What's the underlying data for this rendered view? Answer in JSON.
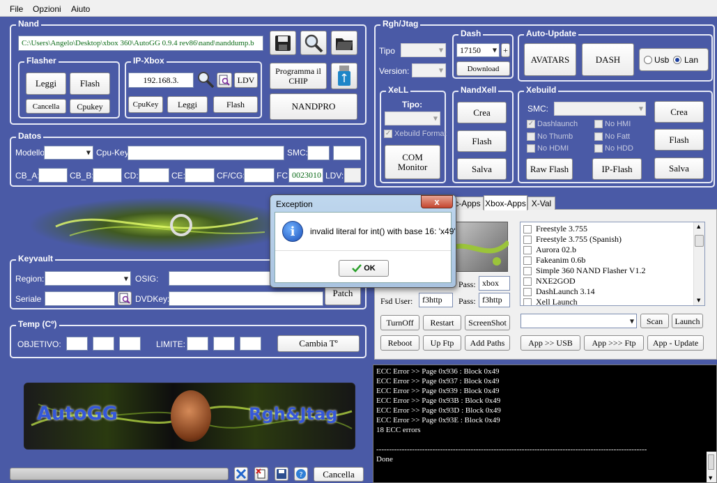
{
  "menu": {
    "file": "File",
    "options": "Opzioni",
    "help": "Aiuto"
  },
  "nand": {
    "title": "Nand",
    "path": "C:\\Users\\Angelo\\Desktop\\xbox 360\\AutoGG 0.9.4 rev86\\nand\\nanddump.b",
    "program_chip": "Programma il CHIP",
    "nandpro": "NANDPRO"
  },
  "flasher": {
    "title": "Flasher",
    "read": "Leggi",
    "flash": "Flash",
    "cancel": "Cancella",
    "cpukey": "Cpukey"
  },
  "ipxbox": {
    "title": "IP-Xbox",
    "ip": "192.168.3.",
    "ldv": "LDV",
    "cpukey": "CpuKey",
    "read": "Leggi",
    "flash": "Flash"
  },
  "rgh": {
    "title": "Rgh/Jtag",
    "type_label": "Tipo",
    "version_label": "Version:"
  },
  "dash": {
    "title": "Dash",
    "value": "17150",
    "plus": "+",
    "download": "Download"
  },
  "autoupdate": {
    "title": "Auto-Update",
    "avatars": "AVATARS",
    "dash": "DASH",
    "usb": "Usb",
    "lan": "Lan"
  },
  "xell": {
    "title": "XeLL",
    "type_label": "Tipo:",
    "xebuild_format": "Xebuild Format",
    "com_monitor": "COM Monitor"
  },
  "nandxell": {
    "title": "NandXell",
    "create": "Crea",
    "flash": "Flash",
    "save": "Salva"
  },
  "xebuild": {
    "title": "Xebuild",
    "smc_label": "SMC:",
    "checks": [
      "Dashlaunch",
      "No HMI",
      "No Thumb",
      "No Fatt",
      "No HDMI",
      "No HDD"
    ],
    "raw_flash": "Raw Flash",
    "ip_flash": "IP-Flash",
    "create": "Crea",
    "flash": "Flash",
    "save": "Salva"
  },
  "datos": {
    "title": "Datos",
    "model_label": "Modello:",
    "cpukey_label": "Cpu-Key",
    "smc_label": "SMC:",
    "cba": "CB_A:",
    "cbb": "CB_B:",
    "cd": "CD:",
    "ce": "CE:",
    "cfcg": "CF/CG:",
    "fc": "FC:",
    "fc_value": "0023010",
    "ldv": "LDV:"
  },
  "keyvault": {
    "title": "Keyvault",
    "region_label": "Region:",
    "osig_label": "OSIG:",
    "serial_label": "Seriale",
    "dvdkey_label": "DVDKey:",
    "patch": "Patch"
  },
  "temp": {
    "title": "Temp (Cº)",
    "target_label": "OBJETIVO:",
    "limit_label": "LIMITE:",
    "change": "Cambia Tº"
  },
  "banner": {
    "left": "AutoGG",
    "right": "Rgh&Jtag"
  },
  "bottom": {
    "cancel": "Cancella"
  },
  "tabs": {
    "apps": "c-Apps",
    "xbox_apps": "Xbox-Apps",
    "xval": "X-Val"
  },
  "ftp": {
    "pass_label": "Pass:",
    "pass1": "xbox",
    "user_label": "Fsd User:",
    "user": "f3http",
    "pass2": "f3http"
  },
  "apps_list": [
    "Freestyle 3.755",
    "Freestyle 3.755 (Spanish)",
    "Aurora 02.b",
    "Fakeanim 0.6b",
    "Simple 360 NAND Flasher V1.2",
    "NXE2GOD",
    "DashLaunch 3.14",
    "Xell Launch"
  ],
  "controls": {
    "turnoff": "TurnOff",
    "restart": "Restart",
    "screenshot": "ScreenShot",
    "reboot": "Reboot",
    "upftp": "Up Ftp",
    "addpaths": "Add Paths",
    "scan": "Scan",
    "launch": "Launch",
    "app_usb": "App >> USB",
    "app_ftp": "App >>> Ftp",
    "app_update": "App - Update"
  },
  "log": [
    "ECC Error >> Page 0x936 : Block 0x49",
    "ECC Error >> Page 0x937 : Block 0x49",
    "ECC Error >> Page 0x939 : Block 0x49",
    "ECC Error >> Page 0x93B : Block 0x49",
    "ECC Error >> Page 0x93D : Block 0x49",
    "ECC Error >> Page 0x93E : Block 0x49",
    "18 ECC errors",
    "",
    "----------------------------------------------------------------------------------------------------------",
    "Done"
  ],
  "dialog": {
    "title": "Exception",
    "message": "invalid literal for int() with base 16: 'x49'",
    "ok": "OK",
    "close": "x"
  }
}
